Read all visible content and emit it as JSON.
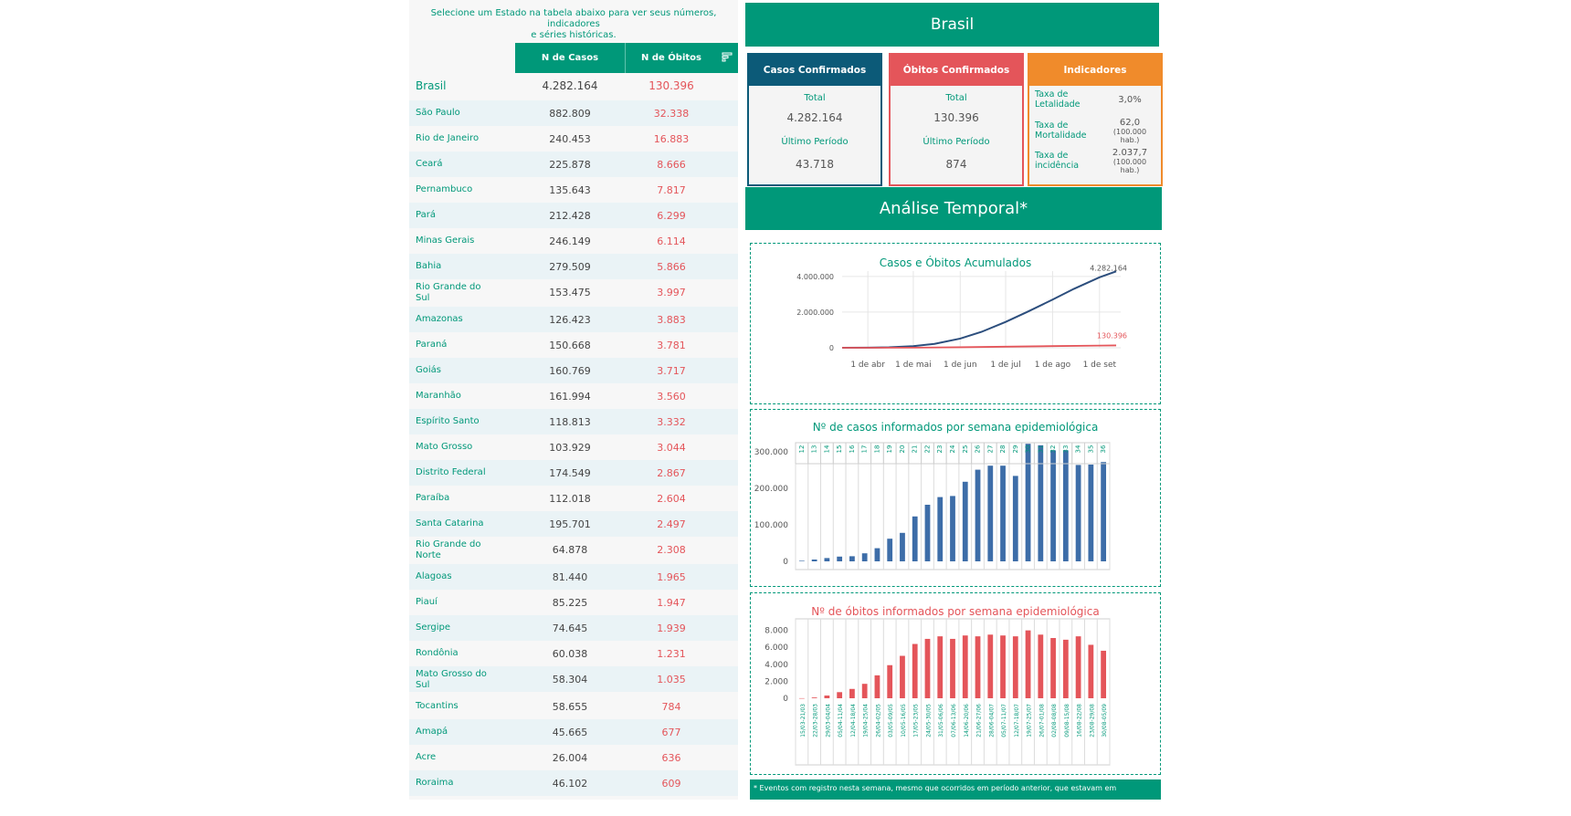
{
  "intro": {
    "line1": "Selecione um Estado na tabela abaixo para ver seus números, indicadores",
    "line2": "e séries históricas."
  },
  "table": {
    "col_cases": "N de Casos",
    "col_deaths": "N de Óbitos",
    "rows": [
      {
        "name": "Brasil",
        "cases": "4.282.164",
        "deaths": "130.396"
      },
      {
        "name": "São Paulo",
        "cases": "882.809",
        "deaths": "32.338"
      },
      {
        "name": "Rio de Janeiro",
        "cases": "240.453",
        "deaths": "16.883"
      },
      {
        "name": "Ceará",
        "cases": "225.878",
        "deaths": "8.666"
      },
      {
        "name": "Pernambuco",
        "cases": "135.643",
        "deaths": "7.817"
      },
      {
        "name": "Pará",
        "cases": "212.428",
        "deaths": "6.299"
      },
      {
        "name": "Minas Gerais",
        "cases": "246.149",
        "deaths": "6.114"
      },
      {
        "name": "Bahia",
        "cases": "279.509",
        "deaths": "5.866"
      },
      {
        "name": "Rio Grande do Sul",
        "cases": "153.475",
        "deaths": "3.997"
      },
      {
        "name": "Amazonas",
        "cases": "126.423",
        "deaths": "3.883"
      },
      {
        "name": "Paraná",
        "cases": "150.668",
        "deaths": "3.781"
      },
      {
        "name": "Goiás",
        "cases": "160.769",
        "deaths": "3.717"
      },
      {
        "name": "Maranhão",
        "cases": "161.994",
        "deaths": "3.560"
      },
      {
        "name": "Espírito Santo",
        "cases": "118.813",
        "deaths": "3.332"
      },
      {
        "name": "Mato Grosso",
        "cases": "103.929",
        "deaths": "3.044"
      },
      {
        "name": "Distrito Federal",
        "cases": "174.549",
        "deaths": "2.867"
      },
      {
        "name": "Paraíba",
        "cases": "112.018",
        "deaths": "2.604"
      },
      {
        "name": "Santa Catarina",
        "cases": "195.701",
        "deaths": "2.497"
      },
      {
        "name": "Rio Grande do Norte",
        "cases": "64.878",
        "deaths": "2.308"
      },
      {
        "name": "Alagoas",
        "cases": "81.440",
        "deaths": "1.965"
      },
      {
        "name": "Piauí",
        "cases": "85.225",
        "deaths": "1.947"
      },
      {
        "name": "Sergipe",
        "cases": "74.645",
        "deaths": "1.939"
      },
      {
        "name": "Rondônia",
        "cases": "60.038",
        "deaths": "1.231"
      },
      {
        "name": "Mato Grosso do Sul",
        "cases": "58.304",
        "deaths": "1.035"
      },
      {
        "name": "Tocantins",
        "cases": "58.655",
        "deaths": "784"
      },
      {
        "name": "Amapá",
        "cases": "45.665",
        "deaths": "677"
      },
      {
        "name": "Acre",
        "cases": "26.004",
        "deaths": "636"
      },
      {
        "name": "Roraima",
        "cases": "46.102",
        "deaths": "609"
      }
    ]
  },
  "header": {
    "title": "Brasil"
  },
  "cards": {
    "cases": {
      "title": "Casos Confirmados",
      "total_label": "Total",
      "total": "4.282.164",
      "period_label": "Último Período",
      "period": "43.718"
    },
    "deaths": {
      "title": "Óbitos Confirmados",
      "total_label": "Total",
      "total": "130.396",
      "period_label": "Último Período",
      "period": "874"
    },
    "indicators": {
      "title": "Indicadores",
      "letalidade_label": "Taxa de Letalidade",
      "letalidade": "3,0%",
      "mortalidade_label": "Taxa de Mortalidade",
      "mortalidade": "62,0",
      "mortalidade_unit": "(100.000 hab.)",
      "incidencia_label": "Taxa de incidência",
      "incidencia": "2.037,7",
      "incidencia_unit": "(100.000 hab.)"
    }
  },
  "section": {
    "title": "Análise Temporal*"
  },
  "chart_data": [
    {
      "type": "line",
      "title": "Casos e Óbitos Acumulados",
      "x_ticks": [
        "1 de abr",
        "1 de mai",
        "1 de jun",
        "1 de jul",
        "1 de ago",
        "1 de set"
      ],
      "y_ticks": [
        "4.000.000",
        "2.000.000",
        "0"
      ],
      "ylim": [
        0,
        4300000
      ],
      "series": [
        {
          "x": [
            "2020-03-15",
            "2020-04-01",
            "2020-04-15",
            "2020-05-01",
            "2020-05-15",
            "2020-06-01",
            "2020-06-15",
            "2020-07-01",
            "2020-07-15",
            "2020-08-01",
            "2020-08-15",
            "2020-09-01",
            "2020-09-12"
          ],
          "values": [
            200,
            6800,
            28000,
            91000,
            218000,
            515000,
            890000,
            1450000,
            2000000,
            2700000,
            3300000,
            3950000,
            4282164
          ],
          "end_label": "4.282.164",
          "color": "#2c4e7d"
        },
        {
          "x": [
            "2020-03-15",
            "2020-04-01",
            "2020-05-01",
            "2020-06-01",
            "2020-07-01",
            "2020-08-01",
            "2020-09-01",
            "2020-09-12"
          ],
          "values": [
            0,
            240,
            6300,
            29000,
            60000,
            93000,
            121000,
            130396
          ],
          "end_label": "130.396",
          "color": "#e4555a"
        }
      ]
    },
    {
      "type": "bar",
      "title": "Nº de casos informados por semana epidemiológica",
      "categories": [
        "12",
        "13",
        "14",
        "15",
        "16",
        "17",
        "18",
        "19",
        "20",
        "21",
        "22",
        "23",
        "24",
        "25",
        "26",
        "27",
        "28",
        "29",
        "30",
        "31",
        "32",
        "33",
        "34",
        "35",
        "36"
      ],
      "values": [
        1500,
        5000,
        9000,
        13000,
        14000,
        22000,
        36000,
        62000,
        78000,
        123000,
        155000,
        176000,
        179000,
        218000,
        251000,
        262000,
        262000,
        234000,
        322000,
        318000,
        304000,
        304000,
        264000,
        265000,
        272000
      ],
      "y_ticks": [
        "300.000",
        "200.000",
        "100.000",
        "0"
      ],
      "ylim": [
        0,
        340000
      ],
      "color": "#3d6da8"
    },
    {
      "type": "bar",
      "title": "Nº de óbitos informados por semana epidemiológica",
      "categories": [
        "15/03-21/03",
        "22/03-28/03",
        "29/03-04/04",
        "05/04-11/04",
        "12/04-18/04",
        "19/04-25/04",
        "26/04-02/05",
        "03/05-09/05",
        "10/05-16/05",
        "17/05-23/05",
        "24/05-30/05",
        "31/05-06/06",
        "07/06-13/06",
        "14/06-20/06",
        "21/06-27/06",
        "28/06-04/07",
        "05/07-11/07",
        "12/07-18/07",
        "19/07-25/07",
        "26/07-01/08",
        "02/08-08/08",
        "09/08-15/08",
        "16/08-22/08",
        "23/08-29/08",
        "30/08-05/09"
      ],
      "values": [
        10,
        90,
        320,
        720,
        1100,
        1700,
        2700,
        3900,
        5000,
        6400,
        7000,
        7300,
        7000,
        7400,
        7300,
        7500,
        7400,
        7300,
        8000,
        7500,
        7100,
        6900,
        7300,
        6300,
        5600
      ],
      "y_ticks": [
        "8.000",
        "6.000",
        "4.000",
        "2.000",
        "0"
      ],
      "ylim": [
        0,
        8500
      ],
      "color": "#e4555a"
    }
  ],
  "footer": {
    "note": "* Eventos com registro nesta semana, mesmo que ocorridos em período anterior, que estavam em investigação."
  }
}
